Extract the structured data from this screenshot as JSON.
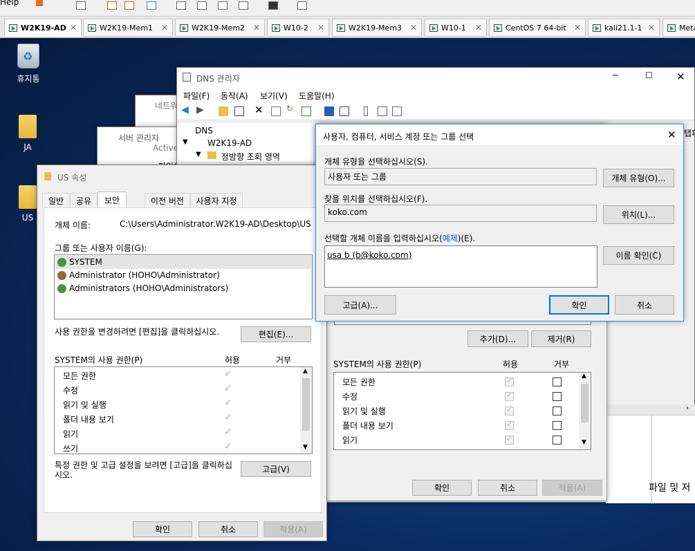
{
  "vm": {
    "help_label": "Help",
    "tabs": [
      {
        "label": "W2K19-AD",
        "active": true
      },
      {
        "label": "W2K19-Mem1"
      },
      {
        "label": "W2K19-Mem2"
      },
      {
        "label": "W10-2"
      },
      {
        "label": "W2K19-Mem3"
      },
      {
        "label": "W10-1"
      },
      {
        "label": "CentOS 7 64-bit"
      },
      {
        "label": "kali21.1-1"
      },
      {
        "label": "Meta"
      }
    ]
  },
  "desktop": {
    "icons": [
      {
        "label": "휴지통"
      },
      {
        "label": "JA"
      },
      {
        "label": "US"
      }
    ]
  },
  "bg_windows": {
    "network_title": "네트워",
    "server_manager_title": "서버 관리자",
    "active_title": "Active",
    "file_menu": "파일(F)"
  },
  "dns": {
    "title": "DNS 관리자",
    "menu": [
      "파일(F)",
      "동작(A)",
      "보기(V)",
      "도움말(H)"
    ],
    "tree": {
      "root": "DNS",
      "server": "W2K19-AD",
      "zone": "정방향 조회 영역"
    },
    "right_fragment": "탭파",
    "bottom_fragment": "파일 및 저"
  },
  "us_props": {
    "title": "US 속성",
    "tabs": [
      "일반",
      "공유",
      "보안",
      "이전 버전",
      "사용자 지정"
    ],
    "active_tab": "보안",
    "object_name_label": "개체 이름:",
    "object_name_value": "C:\\Users\\Administrator.W2K19-AD\\Desktop\\US",
    "group_label": "그룹 또는 사용자 이름(G):",
    "users": [
      {
        "name": "SYSTEM",
        "selected": true
      },
      {
        "name": "Administrator (HOHO\\Administrator)"
      },
      {
        "name": "Administrators (HOHO\\Administrators)"
      }
    ],
    "edit_hint": "사용 권한을 변경하려면 [편집]을 클릭하십시오.",
    "edit_button": "편집(E)...",
    "perm_header": "SYSTEM의 사용 권한(P)",
    "allow_header": "허용",
    "deny_header": "거부",
    "permissions": [
      "모든 권한",
      "수정",
      "읽기 및 실행",
      "폴더 내용 보기",
      "읽기",
      "쓰기"
    ],
    "advanced_hint": "특정 권한 및 고급 설정을 보려면 [고급]을 클릭하십시오.",
    "advanced_button": "고급(V)",
    "ok": "확인",
    "cancel": "취소",
    "apply": "적용(A)"
  },
  "perm_dialog": {
    "add_button": "추가(D)...",
    "remove_button": "제거(R)",
    "perm_header": "SYSTEM의 사용 권한(P)",
    "allow_header": "허용",
    "deny_header": "거부",
    "permissions": [
      "모든 권한",
      "수정",
      "읽기 및 실행",
      "폴더 내용 보기",
      "읽기"
    ],
    "ok": "확인",
    "cancel": "취소",
    "apply": "적용(A)"
  },
  "select_dialog": {
    "title": "사용자, 컴퓨터, 서비스 계정 또는 그룹 선택",
    "object_type_label": "개체 유형을 선택하십시오(S).",
    "object_type_value": "사용자 또는 그룹",
    "object_type_button": "개체 유형(O)...",
    "location_label": "찾을 위치를 선택하십시오(F).",
    "location_value": "koko.com",
    "location_button": "위치(L)...",
    "names_label_prefix": "선택할 개체 이름을 입력하십시오(",
    "names_label_link": "예제",
    "names_label_suffix": ")(E).",
    "names_value": "usa b (b@koko.com)",
    "check_names_button": "이름 확인(C)",
    "advanced_button": "고급(A)...",
    "ok": "확인",
    "cancel": "취소"
  }
}
